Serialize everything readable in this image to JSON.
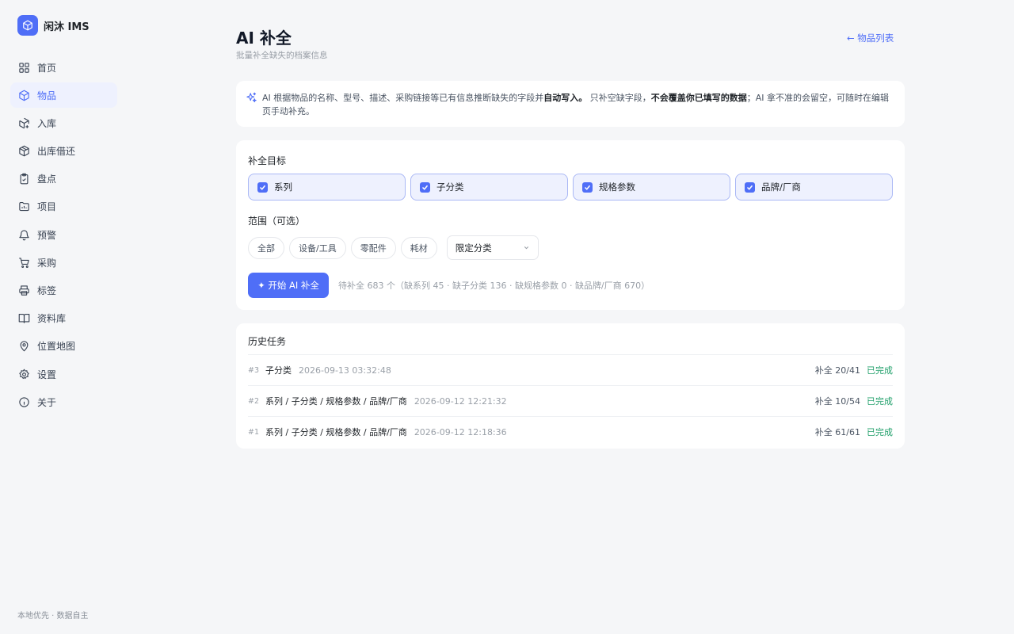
{
  "brand": {
    "name": "闲沐 IMS",
    "logo_icon": "cube-icon",
    "accent": "#4f6ef7"
  },
  "nav": [
    {
      "label": "首页",
      "icon": "dashboard-icon",
      "active": false
    },
    {
      "label": "物品",
      "icon": "cube-icon",
      "active": true
    },
    {
      "label": "入库",
      "icon": "package-in-icon",
      "active": false
    },
    {
      "label": "出库借还",
      "icon": "package-out-icon",
      "active": false
    },
    {
      "label": "盘点",
      "icon": "clipboard-check-icon",
      "active": false
    },
    {
      "label": "项目",
      "icon": "folder-chart-icon",
      "active": false
    },
    {
      "label": "预警",
      "icon": "bell-icon",
      "active": false
    },
    {
      "label": "采购",
      "icon": "cart-icon",
      "active": false
    },
    {
      "label": "标签",
      "icon": "printer-icon",
      "active": false
    },
    {
      "label": "资料库",
      "icon": "book-icon",
      "active": false
    },
    {
      "label": "位置地图",
      "icon": "map-pin-icon",
      "active": false
    },
    {
      "label": "设置",
      "icon": "gear-icon",
      "active": false
    },
    {
      "label": "关于",
      "icon": "info-icon",
      "active": false
    }
  ],
  "footer": "本地优先 · 数据自主",
  "header": {
    "title": "AI 补全",
    "subtitle": "批量补全缺失的档案信息",
    "back_link": "← 物品列表"
  },
  "notice": {
    "p1": "AI 根据物品的名称、型号、描述、采购链接等已有信息推断缺失的字段并",
    "b1": "自动写入。",
    "p2": " 只补空缺字段，",
    "b2": "不会覆盖你已填写的数据",
    "p3": "；AI 拿不准的会留空，可随时在编辑页手动补充。"
  },
  "targets": {
    "label": "补全目标",
    "items": [
      {
        "label": "系列",
        "checked": true
      },
      {
        "label": "子分类",
        "checked": true
      },
      {
        "label": "规格参数",
        "checked": true
      },
      {
        "label": "品牌/厂商",
        "checked": true
      }
    ]
  },
  "scope": {
    "label": "范围（可选）",
    "chips": [
      "全部",
      "设备/工具",
      "零配件",
      "耗材"
    ],
    "select_value": "限定分类"
  },
  "start_button": "✦ 开始 AI 补全",
  "pending_text": "待补全 683 个（缺系列 45 · 缺子分类 136 · 缺规格参数 0 · 缺品牌/厂商 670）",
  "history": {
    "title": "历史任务",
    "rows": [
      {
        "id": "#3",
        "fields": "子分类",
        "time": "2026-09-13 03:32:48",
        "count": "补全 20/41",
        "status": "已完成"
      },
      {
        "id": "#2",
        "fields": "系列 / 子分类 / 规格参数 / 品牌/厂商",
        "time": "2026-09-12 12:21:32",
        "count": "补全 10/54",
        "status": "已完成"
      },
      {
        "id": "#1",
        "fields": "系列 / 子分类 / 规格参数 / 品牌/厂商",
        "time": "2026-09-12 12:18:36",
        "count": "补全 61/61",
        "status": "已完成"
      }
    ]
  }
}
